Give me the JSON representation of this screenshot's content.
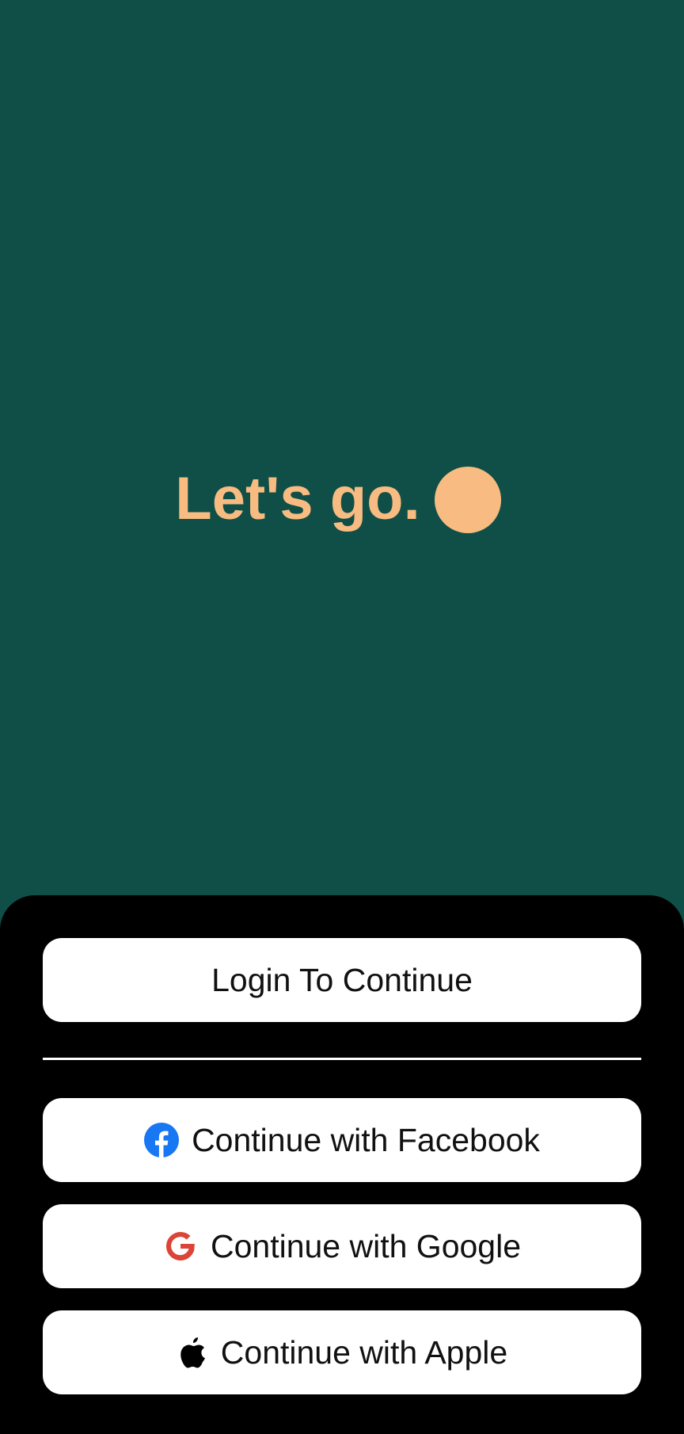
{
  "hero": {
    "headline": "Let's go."
  },
  "auth": {
    "login_label": "Login To Continue",
    "facebook_label": "Continue with Facebook",
    "google_label": "Continue with Google",
    "apple_label": "Continue with Apple"
  },
  "icons": {
    "facebook": "facebook-icon",
    "google": "google-icon",
    "apple": "apple-icon"
  },
  "colors": {
    "background": "#0f4f47",
    "accent": "#f8bb81",
    "sheet": "#000000",
    "button": "#ffffff",
    "facebook": "#1877f2",
    "google": "#db4437"
  }
}
